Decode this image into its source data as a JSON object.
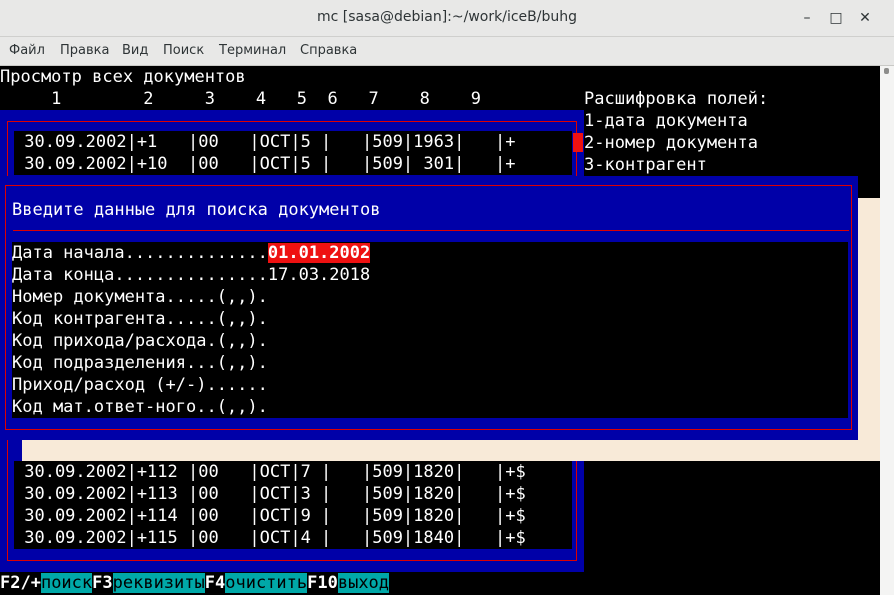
{
  "window": {
    "title": "mc [sasa@debian]:~/work/iceB/buhg",
    "minimize_icon": "minimize-icon",
    "maximize_icon": "maximize-icon",
    "close_icon": "close-icon"
  },
  "menubar": [
    "Файл",
    "Правка",
    "Вид",
    "Поиск",
    "Терминал",
    "Справка"
  ],
  "list": {
    "title": "Просмотр всех документов",
    "column_numbers": "     1        2     3    4   5  6   7    8    9",
    "rows_top": [
      " 30.09.2002|+1   |00   |ОСТ|5 |   |509|1963|   |+",
      " 30.09.2002|+10  |00   |ОСТ|5 |   |509| 301|   |+"
    ],
    "rows_bottom": [
      " 30.09.2002|+112 |00   |ОСТ|7 |   |509|1820|   |+$",
      " 30.09.2002|+113 |00   |ОСТ|3 |   |509|1820|   |+$",
      " 30.09.2002|+114 |00   |ОСТ|9 |   |509|1820|   |+$",
      " 30.09.2002|+115 |00   |ОСТ|4 |   |509|1840|   |+$"
    ]
  },
  "legend": {
    "title": "Расшифровка полей:",
    "items": [
      "1-дата документа",
      "2-номер документа",
      "3-контрагент"
    ]
  },
  "dialog": {
    "title": "Введите данные для поиска документов",
    "fields": [
      {
        "label": "Дата начала..............",
        "value": "01.01.2002"
      },
      {
        "label": "Дата конца...............",
        "value": "17.03.2018"
      },
      {
        "label": "Номер документа.....(,,).",
        "value": ""
      },
      {
        "label": "Код контрагента.....(,,).",
        "value": ""
      },
      {
        "label": "Код прихода/расхода.(,,).",
        "value": ""
      },
      {
        "label": "Код подразделения...(,,).",
        "value": ""
      },
      {
        "label": "Приход/расход (+/-)......",
        "value": ""
      },
      {
        "label": "Код мат.ответ-ного..(,,).",
        "value": ""
      }
    ]
  },
  "fkeys": [
    {
      "key": "F2/+",
      "label": "поиск"
    },
    {
      "key": "F3",
      "label": "реквизиты"
    },
    {
      "key": "F4",
      "label": "очистить"
    },
    {
      "key": "F10",
      "label": "выход"
    }
  ],
  "colors": {
    "dialog_bg": "#0000a8",
    "frame": "#dd0000",
    "selection": "#ee1111",
    "fkey_button": "#00a8a8"
  }
}
